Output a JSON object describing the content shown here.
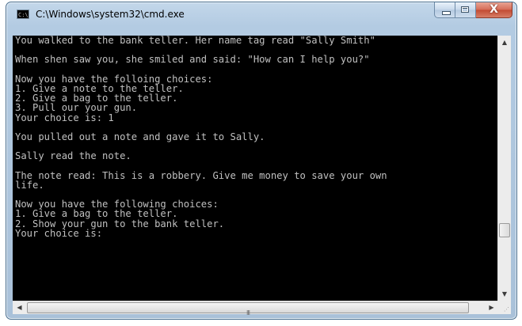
{
  "window": {
    "title": "C:\\Windows\\system32\\cmd.exe",
    "app_icon_text": "C:\\"
  },
  "caption_buttons": {
    "close_glyph": "X"
  },
  "console": {
    "lines": [
      "You walked to the bank teller. Her name tag read \"Sally Smith\"",
      "",
      "When shen saw you, she smiled and said: \"How can I help you?\"",
      "",
      "Now you have the folloing choices:",
      "1. Give a note to the teller.",
      "2. Give a bag to the teller.",
      "3. Pull our your gun.",
      "Your choice is: 1",
      "",
      "You pulled out a note and gave it to Sally.",
      "",
      "Sally read the note.",
      "",
      "The note read: This is a robbery. Give me money to save your own",
      "life.",
      "",
      "Now you have the following choices:",
      "1. Give a bag to the teller.",
      "2. Show your gun to the bank teller.",
      "Your choice is: "
    ]
  },
  "scrollbars": {
    "up_arrow": "▲",
    "down_arrow": "▼",
    "left_arrow": "◀",
    "right_arrow": "▶",
    "grip": "III"
  }
}
